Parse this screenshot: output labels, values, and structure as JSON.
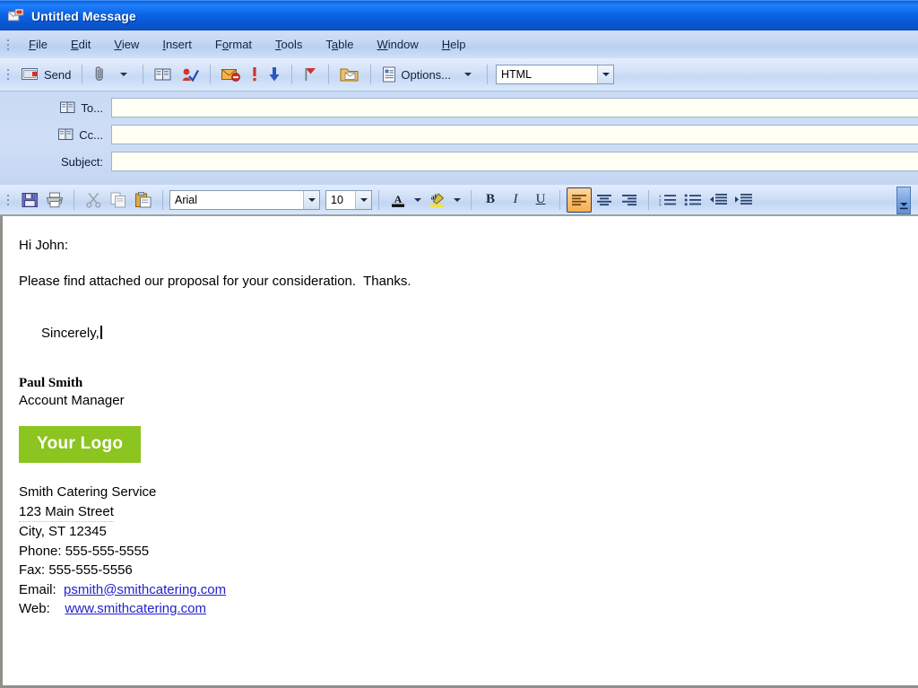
{
  "window": {
    "title": "Untitled Message",
    "title_icon": "message-envelope-icon"
  },
  "menubar": {
    "items": [
      {
        "label": "File",
        "accel": "F"
      },
      {
        "label": "Edit",
        "accel": "E"
      },
      {
        "label": "View",
        "accel": "V"
      },
      {
        "label": "Insert",
        "accel": "I"
      },
      {
        "label": "Format",
        "accel": "o"
      },
      {
        "label": "Tools",
        "accel": "T"
      },
      {
        "label": "Table",
        "accel": "a"
      },
      {
        "label": "Window",
        "accel": "W"
      },
      {
        "label": "Help",
        "accel": "H"
      }
    ]
  },
  "standard_toolbar": {
    "send_label": "Send",
    "options_label": "Options...",
    "format_combo_value": "HTML",
    "buttons": [
      "send-button",
      "attach-file-button",
      "attach-dropdown-button",
      "address-book-button",
      "check-names-button",
      "follow-up-flag-button",
      "high-importance-button",
      "low-importance-button",
      "flag-button",
      "insert-item-button",
      "options-button"
    ]
  },
  "fields": {
    "to_label": "To...",
    "cc_label": "Cc...",
    "subject_label": "Subject:",
    "to_value": "",
    "cc_value": "",
    "subject_value": ""
  },
  "format_toolbar": {
    "font_name": "Arial",
    "font_size": "10",
    "bold_label": "B",
    "italic_label": "I",
    "underline_label": "U",
    "active_alignment": "align-left",
    "buttons": [
      "save-button",
      "print-button",
      "cut-button",
      "copy-button",
      "paste-button",
      "font-name-combo",
      "font-size-combo",
      "font-color-button",
      "highlight-color-button",
      "bold-button",
      "italic-button",
      "underline-button",
      "align-left-button",
      "align-center-button",
      "align-right-button",
      "numbered-list-button",
      "bulleted-list-button",
      "decrease-indent-button",
      "increase-indent-button",
      "toolbar-overflow-button"
    ]
  },
  "message": {
    "greeting": "Hi John:",
    "body": "Please find attached our proposal for your consideration.  Thanks.",
    "closing": "Sincerely,",
    "signature": {
      "name": "Paul Smith",
      "title": "Account Manager",
      "logo_text": "Your Logo",
      "logo_color": "#8cc420",
      "company": "Smith Catering Service",
      "street": "123 Main Street",
      "city_state_zip": "City, ST 12345",
      "phone_label": "Phone: ",
      "phone": "555-555-5555",
      "fax_label": "Fax: ",
      "fax": "555-555-5556",
      "email_label": "Email:  ",
      "email": "psmith@smithcatering.com",
      "web_label": "Web:    ",
      "web": "www.smithcatering.com",
      "link_color": "#2222cc"
    }
  }
}
